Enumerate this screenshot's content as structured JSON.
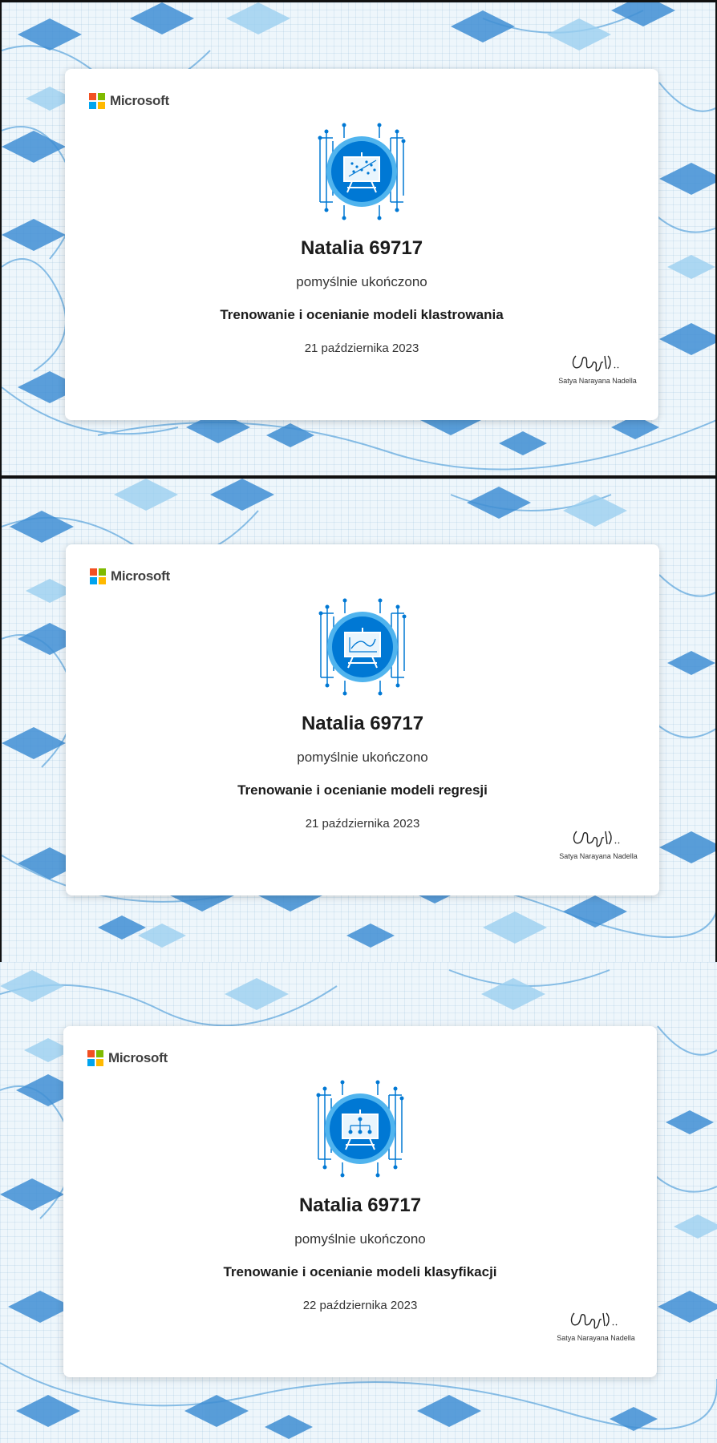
{
  "brand": {
    "name": "Microsoft",
    "colors": [
      "#f25022",
      "#7fba00",
      "#00a4ef",
      "#ffb900"
    ]
  },
  "certificates": [
    {
      "recipient": "Natalia 69717",
      "completed_text": "pomyślnie ukończono",
      "course": "Trenowanie i ocenianie modeli klastrowania",
      "date": "21 października 2023",
      "signer": "Satya Narayana Nadella",
      "badge_icon": "scatter-plot-easel-icon"
    },
    {
      "recipient": "Natalia 69717",
      "completed_text": "pomyślnie ukończono",
      "course": "Trenowanie i ocenianie modeli regresji",
      "date": "21 października 2023",
      "signer": "Satya Narayana Nadella",
      "badge_icon": "line-chart-easel-icon"
    },
    {
      "recipient": "Natalia 69717",
      "completed_text": "pomyślnie ukończono",
      "course": "Trenowanie i ocenianie modeli klasyfikacji",
      "date": "22 października 2023",
      "signer": "Satya Narayana Nadella",
      "badge_icon": "tree-diagram-easel-icon"
    }
  ],
  "theme": {
    "badge_blue": "#0078d4",
    "badge_light": "#50b4ee",
    "pattern_blue": "#2e77c0"
  }
}
